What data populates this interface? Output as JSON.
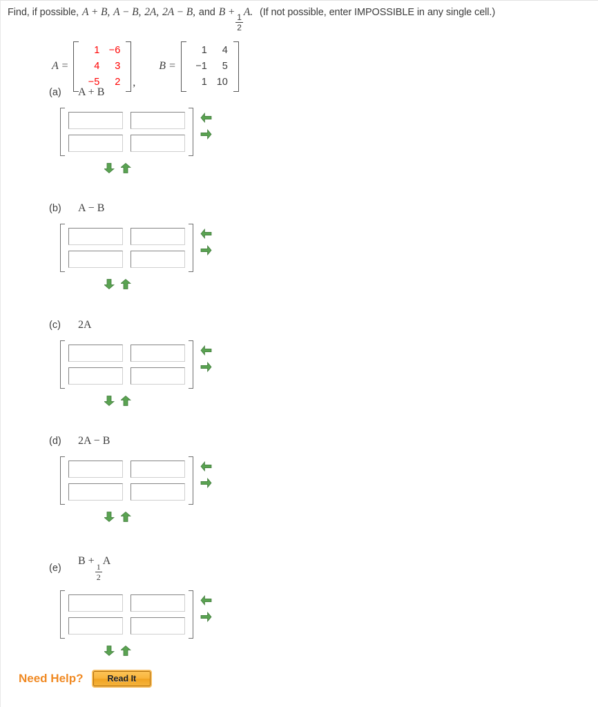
{
  "prompt": {
    "lead": "Find, if possible,",
    "expr1": "A + B,",
    "expr2": "A − B,",
    "expr3": "2A,",
    "expr4": "2A − B,",
    "and": "and",
    "expr5_pre": "B +",
    "expr5_frac_num": "1",
    "expr5_frac_den": "2",
    "expr5_post": "A.",
    "note": "(If not possible, enter IMPOSSIBLE in any single cell.)"
  },
  "given": {
    "a_label": "A =",
    "a_color": "#ff0000",
    "a_rows": [
      [
        "1",
        "−6"
      ],
      [
        "4",
        "3"
      ],
      [
        "−5",
        "2"
      ]
    ],
    "separator": ",",
    "b_label": "B =",
    "b_color": "#3c3c3c",
    "b_rows": [
      [
        "1",
        "4"
      ],
      [
        "−1",
        "5"
      ],
      [
        "1",
        "10"
      ]
    ]
  },
  "parts": [
    {
      "tag": "(a)",
      "expr": "A + B",
      "cells": [
        [
          "",
          ""
        ],
        [
          "",
          ""
        ]
      ],
      "placeholder": ""
    },
    {
      "tag": "(b)",
      "expr": "A − B",
      "cells": [
        [
          "",
          ""
        ],
        [
          "",
          ""
        ]
      ],
      "placeholder": ""
    },
    {
      "tag": "(c)",
      "expr": "2A",
      "cells": [
        [
          "",
          ""
        ],
        [
          "",
          ""
        ]
      ],
      "placeholder": ""
    },
    {
      "tag": "(d)",
      "expr": "2A − B",
      "cells": [
        [
          "",
          ""
        ],
        [
          "",
          ""
        ]
      ],
      "placeholder": ""
    },
    {
      "tag": "(e)",
      "expr_pre": "B +",
      "expr_frac_num": "1",
      "expr_frac_den": "2",
      "expr_post": "A",
      "cells": [
        [
          "",
          ""
        ],
        [
          "",
          ""
        ]
      ],
      "placeholder": ""
    }
  ],
  "controls": {
    "remove_column": "remove-column-arrow",
    "add_column": "add-column-arrow",
    "add_row": "add-row-arrow",
    "remove_row": "remove-row-arrow",
    "arrow_color": "#5aa352"
  },
  "footer": {
    "need_help_label": "Need Help?",
    "read_it_label": "Read It",
    "accent_color": "#f08a24"
  }
}
